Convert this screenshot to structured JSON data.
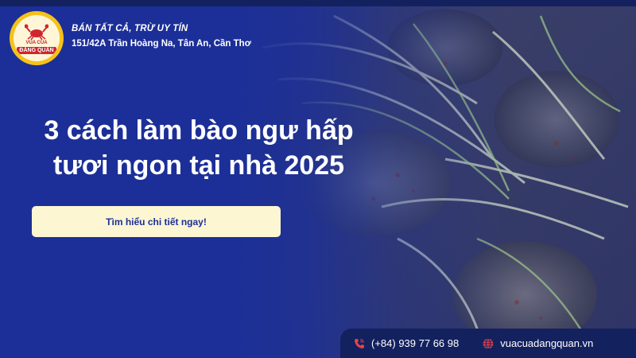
{
  "brand": {
    "logo_line1": "VUA CUA",
    "logo_line2": "ĐĂNG QUÂN",
    "tagline": "BÁN TẤT CẢ, TRỪ UY TÍN",
    "address": "151/42A Trần Hoàng Na, Tân An, Cần Thơ"
  },
  "headline": {
    "line1": "3 cách làm bào ngư hấp",
    "line2": "tươi ngon tại nhà 2025"
  },
  "cta": {
    "label": "Tìm hiểu chi tiết ngay!"
  },
  "footer": {
    "phone": "(+84) 939 77 66 98",
    "website": "vuacuadangquan.vn"
  },
  "icons": [
    "phone-icon",
    "globe-icon",
    "crab-icon"
  ],
  "colors": {
    "panel": "#1c2f98",
    "footer": "#14215f",
    "cta_bg": "#fdf6d3",
    "logo_gold": "#f6c21a",
    "accent_red": "#d0262e"
  }
}
